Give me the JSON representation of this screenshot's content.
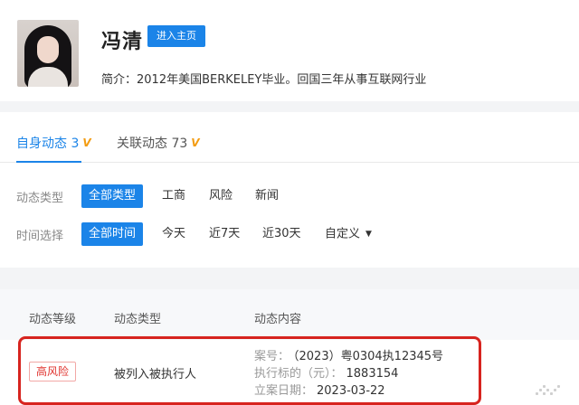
{
  "profile": {
    "name": "冯清",
    "enter_button": "进入主页",
    "intro": "简介：2012年美国BERKELEY毕业。回国三年从事互联网行业"
  },
  "tabs": [
    {
      "label": "自身动态 3",
      "icon": "v-badge-icon",
      "active": true
    },
    {
      "label": "关联动态 73",
      "icon": "v-badge-icon",
      "active": false
    }
  ],
  "filters": {
    "type": {
      "label": "动态类型",
      "options": [
        "全部类型",
        "工商",
        "风险",
        "新闻"
      ],
      "selected": "全部类型"
    },
    "time": {
      "label": "时间选择",
      "options": [
        "全部时间",
        "今天",
        "近7天",
        "近30天",
        "自定义"
      ],
      "selected": "全部时间",
      "custom_icon": "caret-down-icon"
    }
  },
  "table": {
    "headers": [
      "动态等级",
      "动态类型",
      "动态内容"
    ],
    "rows": [
      {
        "level": "高风险",
        "type": "被列入被执行人",
        "details": [
          {
            "key": "案号：",
            "value": "（2023）粤0304执12345号"
          },
          {
            "key": "执行标的（元）：",
            "value": "1883154"
          },
          {
            "key": "立案日期：",
            "value": "2023-03-22"
          }
        ]
      }
    ]
  },
  "colors": {
    "accent": "#1b84e8",
    "risk": "#e0332e",
    "highlight": "#d7241f",
    "v_badge": "#f39c12"
  }
}
